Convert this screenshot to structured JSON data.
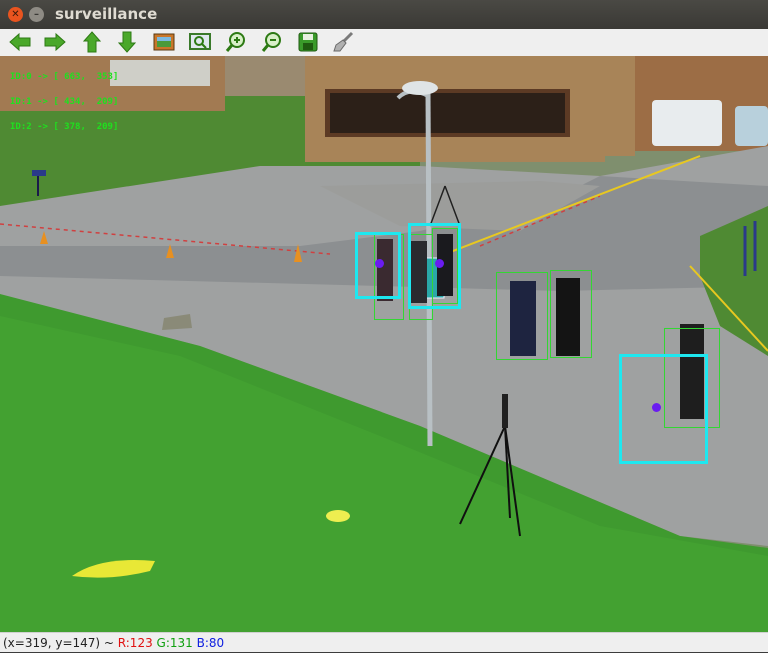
{
  "window": {
    "title": "surveillance"
  },
  "toolbar": {
    "buttons": [
      {
        "name": "pan-left-button",
        "icon": "arrow-left-icon"
      },
      {
        "name": "pan-right-button",
        "icon": "arrow-right-icon"
      },
      {
        "name": "pan-up-button",
        "icon": "arrow-up-icon"
      },
      {
        "name": "pan-down-button",
        "icon": "arrow-down-icon"
      },
      {
        "name": "zoom-fit-button",
        "icon": "image-icon"
      },
      {
        "name": "zoom-original-button",
        "icon": "zoom-select-icon"
      },
      {
        "name": "zoom-in-button",
        "icon": "zoom-in-icon"
      },
      {
        "name": "zoom-out-button",
        "icon": "zoom-out-icon"
      },
      {
        "name": "save-button",
        "icon": "save-icon"
      },
      {
        "name": "properties-button",
        "icon": "brush-icon"
      }
    ]
  },
  "overlay": {
    "lines": [
      "ID:0 -> [ 663,  353]",
      "ID:1 -> [ 434,  209]",
      "ID:2 -> [ 378,  209]"
    ]
  },
  "detections": {
    "green_count": 6,
    "cyan_count": 3
  },
  "status": {
    "coords": "(x=319, y=147) ~ ",
    "r": "R:123",
    "g": "G:131",
    "b": "B:80"
  },
  "colors": {
    "detection_box": "#33d633",
    "track_box": "#1ee8f0",
    "centroid": "#6a1cf0",
    "overlay_text": "#1fe01f"
  }
}
